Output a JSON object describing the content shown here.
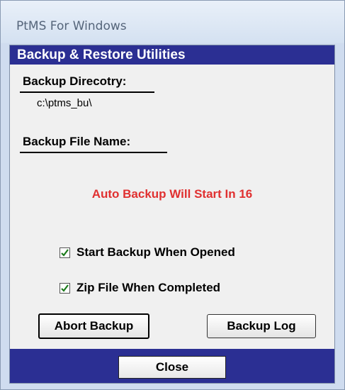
{
  "window": {
    "title": "PtMS For Windows"
  },
  "panel": {
    "header": "Backup & Restore Utilities"
  },
  "backup_dir": {
    "label": "Backup Direcotry:",
    "value": "c:\\ptms_bu\\"
  },
  "backup_file": {
    "label": "Backup File Name:",
    "value": ""
  },
  "status": {
    "text": "Auto Backup Will Start In 16",
    "color": "#e03030"
  },
  "options": [
    {
      "label": "Start Backup When Opened",
      "checked": true
    },
    {
      "label": "Zip File When Completed",
      "checked": true
    }
  ],
  "buttons": {
    "abort": "Abort Backup",
    "log": "Backup Log",
    "close": "Close"
  },
  "colors": {
    "header_bg": "#2b2f93",
    "check": "#1a7a1a"
  }
}
